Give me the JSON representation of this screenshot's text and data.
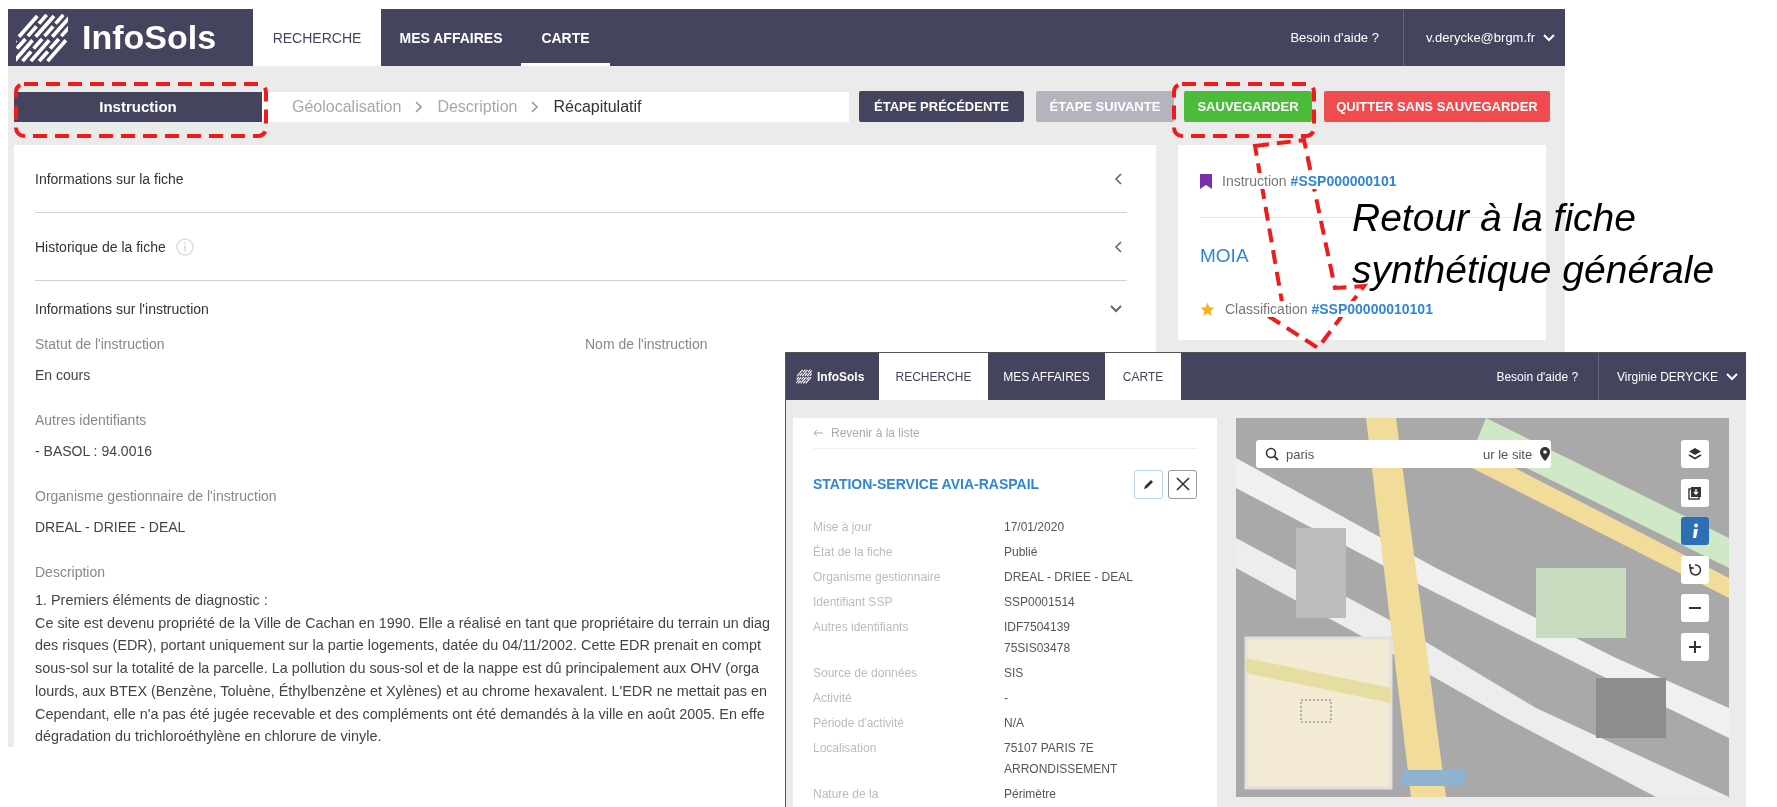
{
  "app": {
    "nav": {
      "logo": "InfoSols",
      "tabs": [
        {
          "label": "RECHERCHE",
          "selected": true,
          "current": false
        },
        {
          "label": "MES AFFAIRES",
          "selected": false,
          "current": false
        },
        {
          "label": "CARTE",
          "selected": false,
          "current": true
        }
      ],
      "help": "Besoin d'aide ?",
      "user": "v.derycke@brgm.fr"
    },
    "stage": "Instruction",
    "steps": [
      {
        "label": "Géolocalisation",
        "selected": false
      },
      {
        "label": "Description",
        "selected": false
      },
      {
        "label": "Récapitulatif",
        "selected": true
      }
    ],
    "buttons": [
      {
        "label": "ÉTAPE PRÉCÉDENTE",
        "kind": "dark",
        "disabled": false
      },
      {
        "label": "ÉTAPE SUIVANTE",
        "kind": "dark",
        "disabled": true
      },
      {
        "label": "SAUVEGARDER",
        "kind": "success",
        "disabled": false
      },
      {
        "label": "QUITTER SANS SAUVEGARDER",
        "kind": "danger",
        "disabled": false
      }
    ],
    "sections": [
      {
        "title": "Informations sur la fiche",
        "info": false,
        "expanded": false
      },
      {
        "title": "Historique de la fiche",
        "info": true,
        "expanded": false
      },
      {
        "title": "Informations sur l'instruction",
        "info": false,
        "expanded": true
      }
    ],
    "field_rows": [
      [
        {
          "label": "Statut de l'instruction",
          "value": "En cours"
        },
        {
          "label": "Nom de l'instruction"
        }
      ],
      [
        {
          "label": "Autres identifiants",
          "value": "- BASOL : 94.0016"
        }
      ],
      [
        {
          "label": "Organisme gestionnaire de l'instruction",
          "value": "DREAL - DRIEE - DEAL"
        }
      ]
    ],
    "description": {
      "label": "Description",
      "lines": [
        "1. Premiers éléments de diagnostic :",
        "Ce site est devenu propriété de la Ville de Cachan en 1990. Elle a réalisé en tant que propriétaire du terrain un diag",
        "des risques (EDR), portant uniquement sur la partie logements, datée du 04/11/2002. Cette EDR prenait en compt",
        "sous-sol sur la totalité de la parcelle. La pollution du sous-sol et de la nappe est dû principalement aux OHV (orga",
        "lourds, aux BTEX (Benzène, Toluène, Éthylbenzène et Xylènes) et au chrome hexavalent. L'EDR ne mettait pas en",
        "Cependant, elle n'a pas été jugée recevable et des compléments ont été demandés à la ville en août 2005. En effe",
        "dégradation du trichloroéthylène en chlorure de vinyle."
      ]
    },
    "summary": {
      "instruction": {
        "label": "Instruction",
        "ref": "#SSP000000101"
      },
      "name": "MOIA",
      "classification": {
        "label": "Classification",
        "ref": "#SSP00000010101"
      }
    }
  },
  "annotation": "Retour à la fiche synthétique générale",
  "overlay": {
    "nav": {
      "logo": "InfoSols",
      "tabs": [
        {
          "label": "RECHERCHE",
          "selected": true
        },
        {
          "label": "MES AFFAIRES",
          "selected": false
        },
        {
          "label": "CARTE",
          "selected": true
        }
      ],
      "help": "Besoin d'aide ?",
      "user": "Virginie DERYCKE"
    },
    "back_link": "Revenir à la liste",
    "title": "STATION-SERVICE AVIA-RASPAIL",
    "rows": [
      {
        "label": "Mise à jour",
        "values": [
          "17/01/2020"
        ]
      },
      {
        "label": "État de la fiche",
        "values": [
          "Publié"
        ]
      },
      {
        "label": "Organisme gestionnaire",
        "values": [
          "DREAL - DRIEE - DEAL"
        ]
      },
      {
        "label": "Identifiant SSP",
        "values": [
          "SSP0001514"
        ]
      },
      {
        "label": "Autres identifiants",
        "values": [
          "IDF7504139",
          "75SIS03478"
        ]
      },
      {
        "label": "Source de données",
        "values": [
          "SIS"
        ]
      },
      {
        "label": "Activité",
        "values": [
          "-"
        ]
      },
      {
        "label": "Période d'activité",
        "values": [
          "N/A"
        ]
      },
      {
        "label": "Localisation",
        "values": [
          "75107 PARIS 7E",
          "ARRONDISSEMENT"
        ]
      },
      {
        "label": "Nature de la",
        "values": [
          "Périmètre"
        ]
      }
    ],
    "map": {
      "kind": "picture",
      "search": "paris",
      "locate": "ur le site",
      "tools": [
        {
          "kind": "layers",
          "selected": false
        },
        {
          "kind": "export",
          "selected": false
        },
        {
          "kind": "info",
          "selected": true
        },
        {
          "kind": "rotate",
          "selected": false
        },
        {
          "kind": "zoom-out",
          "selected": false
        },
        {
          "kind": "zoom-in",
          "selected": false
        }
      ]
    }
  }
}
